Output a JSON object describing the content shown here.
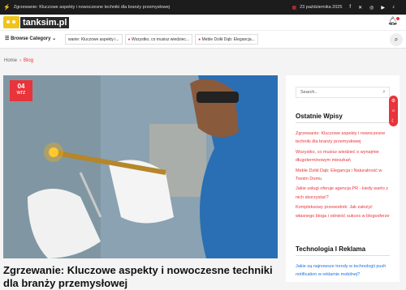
{
  "topbar": {
    "ticker": "Zgrzewanie: Kluczowe aspekty i nowoczesne techniki dla branży przemysłowej",
    "date": "23 października 2025",
    "social_icons": [
      "facebook-icon",
      "twitter-icon",
      "instagram-icon",
      "youtube-icon",
      "tiktok-icon"
    ]
  },
  "header": {
    "logo_text": "tanksim.pl"
  },
  "nav": {
    "browse_label": "Browse Category",
    "links": [
      "wanie: Kluczowe aspekty i...",
      "Wszystko, co musisz wiedziec...",
      "Meble Dzikł Dąb: Elegancja..."
    ]
  },
  "breadcrumb": {
    "home": "Home",
    "current": "Blog"
  },
  "post": {
    "day": "04",
    "month": "wrz",
    "title": "Zgrzewanie: Kluczowe aspekty i nowoczesne techniki dla branży przemysłowej"
  },
  "sidebar": {
    "search_placeholder": "Search..",
    "recent_heading": "Ostatnie Wpisy",
    "recent_posts": [
      "Zgrzewanie: Kluczowe aspekty i nowoczesne techniki dla branży przemysłowej",
      "Wszystko, co musisz wiedzieć o wynajmie długoterminowym mieszkań",
      "Meble Dzikł Dąb: Elegancja i Naturalność w Twoim Domu",
      "Jakie usługi oferuje agencja PR - kiedy warto z nich skorzystać?",
      "Kompleksowy przewodnik: Jak założyć własnego bloga i odnieść sukces w blogosferze"
    ],
    "tech_heading": "Technologia I Reklama",
    "tech_posts": [
      "Jakie są najnowsze trendy w technologii push notification w reklamie mobilnej?"
    ]
  },
  "colors": {
    "accent": "#e8343a",
    "dark": "#1c1c1c",
    "link_blue": "#1a73e8"
  }
}
